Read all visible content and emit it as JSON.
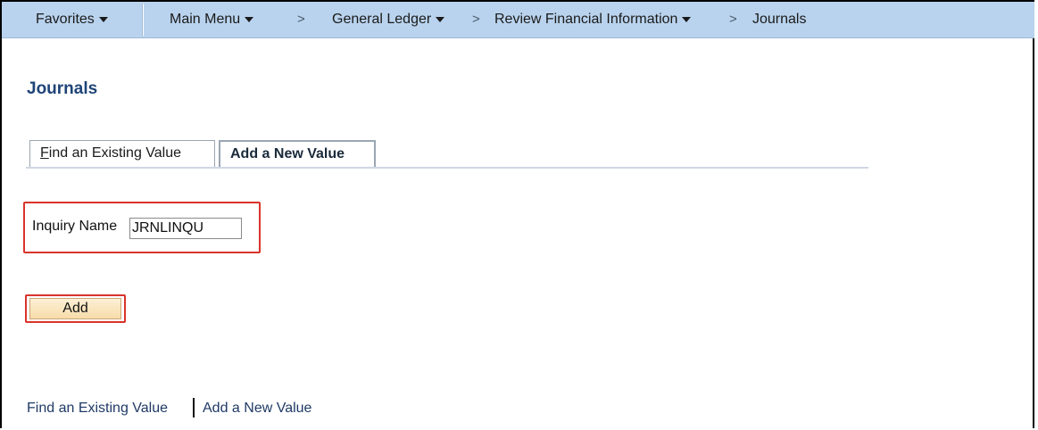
{
  "navbar": {
    "favorites": "Favorites",
    "main_menu": "Main Menu",
    "chevron": ">",
    "crumb_gl": "General Ledger",
    "crumb_rfi": "Review Financial Information",
    "crumb_journals": "Journals"
  },
  "page": {
    "title": "Journals"
  },
  "tabs": {
    "find_rest": "ind an Existing Value",
    "find_mnemonic": "F",
    "add": "Add a New Value"
  },
  "form": {
    "inquiry_label": "Inquiry Name",
    "inquiry_value": "JRNLINQU",
    "add_button": "Add"
  },
  "footer": {
    "find_link": "Find an Existing Value",
    "add_link": "Add a New Value"
  },
  "colors": {
    "navbar_bg": "#b9d3ee",
    "title": "#1f4477",
    "highlight": "#d9342b",
    "button_bg": "#f7dcaa"
  }
}
